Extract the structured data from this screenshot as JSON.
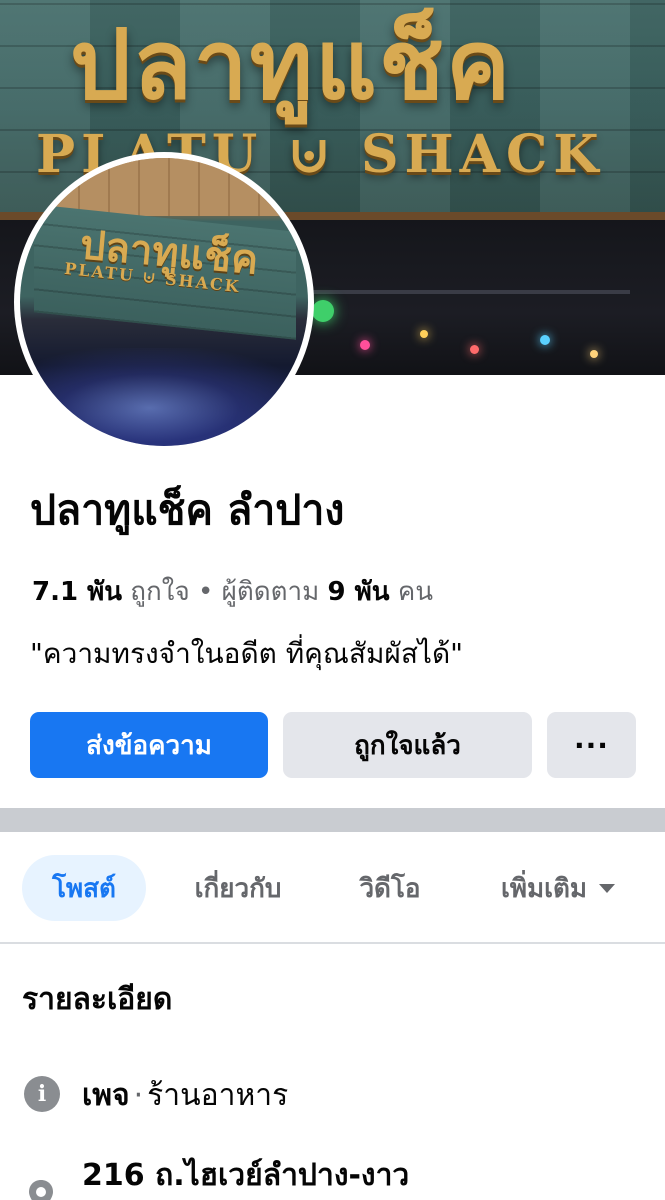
{
  "cover": {
    "sign_thai": "ปลาทูแช็ค",
    "sign_english": "PLATU ⊍ SHACK"
  },
  "avatar": {
    "sign_thai": "ปลาทูแช็ค",
    "sign_english": "PLATU ⊍ SHACK"
  },
  "page": {
    "name": "ปลาทูแช็ค ลำปาง",
    "likes_count": "7.1 พัน",
    "likes_label": "ถูกใจ",
    "separator": "•",
    "followers_label": "ผู้ติดตาม",
    "followers_count": "9 พัน",
    "followers_unit": "คน",
    "tagline": "\"ความทรงจำในอดีต ที่คุณสัมผัสได้\""
  },
  "actions": {
    "message_label": "ส่งข้อความ",
    "liked_label": "ถูกใจแล้ว",
    "more_label": "···"
  },
  "tabs": [
    {
      "label": "โพสต์"
    },
    {
      "label": "เกี่ยวกับ"
    },
    {
      "label": "วิดีโอ"
    },
    {
      "label": "เพิ่มเติม"
    }
  ],
  "details": {
    "title": "รายละเอียด",
    "info_icon_glyph": "i",
    "page_label": "เพจ",
    "dot": "·",
    "category": "ร้านอาหาร",
    "address": "216 ถ.ไฮเวย์ลำปาง-งาว"
  },
  "colors": {
    "primary": "#1877f2",
    "secondary_button": "#e4e6eb",
    "active_tab_bg": "#e7f3ff",
    "muted_text": "#65676b",
    "sign_gold": "#d8aa52"
  }
}
